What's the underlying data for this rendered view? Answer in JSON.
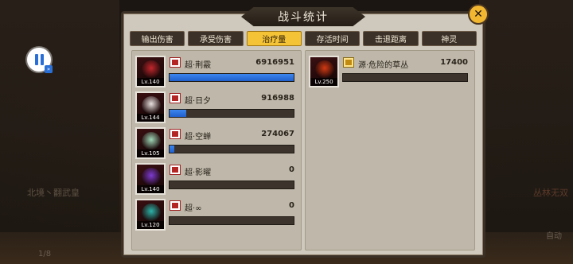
{
  "dialog": {
    "title": "战斗统计",
    "close_label": "✕"
  },
  "tabs": [
    {
      "label": "输出伤害",
      "active": false
    },
    {
      "label": "承受伤害",
      "active": false
    },
    {
      "label": "治疗量",
      "active": true
    },
    {
      "label": "存活时间",
      "active": false
    },
    {
      "label": "击退距离",
      "active": false
    },
    {
      "label": "神灵",
      "active": false
    }
  ],
  "left_team": [
    {
      "level": "Lv.140",
      "name": "超·荆霰",
      "value": "6916951",
      "fill": 1.0,
      "art_color": "#c2272d"
    },
    {
      "level": "Lv.144",
      "name": "超·日夕",
      "value": "916988",
      "fill": 0.132,
      "art_color": "#e8e2e0"
    },
    {
      "level": "Lv.105",
      "name": "超·空蝉",
      "value": "274067",
      "fill": 0.04,
      "art_color": "#9fd8b8"
    },
    {
      "level": "Lv.140",
      "name": "超·影曜",
      "value": "0",
      "fill": 0.0,
      "art_color": "#7d3bd1"
    },
    {
      "level": "Lv.120",
      "name": "超·∞",
      "value": "0",
      "fill": 0.0,
      "art_color": "#2bb3a8"
    }
  ],
  "right_team": [
    {
      "level": "Lv.250",
      "name": "源·危险的草丛",
      "value": "17400",
      "fill": 0.0,
      "art_color": "#d23a12"
    }
  ],
  "background": {
    "left_label": "北境丶翻武皇",
    "right_label": "丛林无双",
    "auto_label": "自动",
    "count_label": "1/8"
  },
  "colors": {
    "accent_tab": "#f5c336",
    "bar_fill": "#2a6fd6",
    "dialog_bg": "#cfc9bd"
  }
}
